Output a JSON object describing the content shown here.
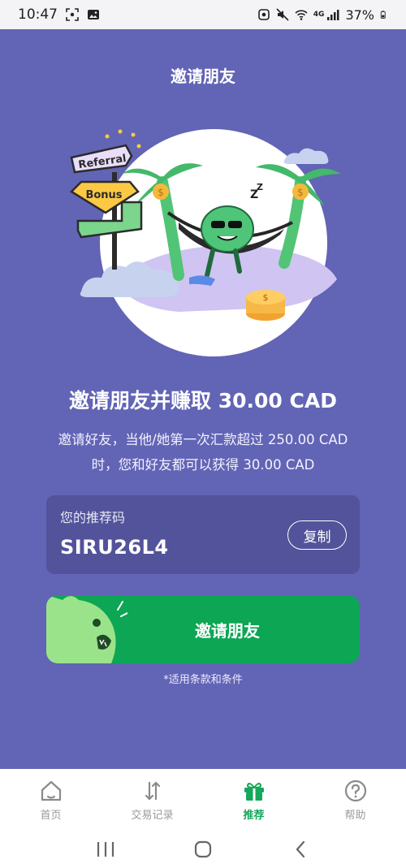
{
  "status_bar": {
    "time": "10:47",
    "battery": "37%",
    "network": "4G"
  },
  "page": {
    "title": "邀请朋友",
    "headline": "邀请朋友并赚取 30.00 CAD",
    "description_line1": "邀请好友，当他/她第一次汇款超过 250.00 CAD",
    "description_line2": "时，您和好友都可以获得 30.00 CAD"
  },
  "illustration": {
    "sign_top": "Referral",
    "sign_bonus": "Bonus"
  },
  "referral": {
    "label": "您的推荐码",
    "code": "SIRU26L4",
    "copy_label": "复制"
  },
  "invite": {
    "button_label": "邀请朋友",
    "terms": "*适用条款和条件"
  },
  "bottom_nav": {
    "items": [
      {
        "label": "首页",
        "icon": "home-icon"
      },
      {
        "label": "交易记录",
        "icon": "transactions-icon"
      },
      {
        "label": "推荐",
        "icon": "gift-icon",
        "active": true
      },
      {
        "label": "帮助",
        "icon": "help-icon"
      }
    ]
  },
  "colors": {
    "background": "#6264b5",
    "card": "#52539a",
    "accent_green": "#0da654",
    "nav_active": "#16a75c"
  }
}
